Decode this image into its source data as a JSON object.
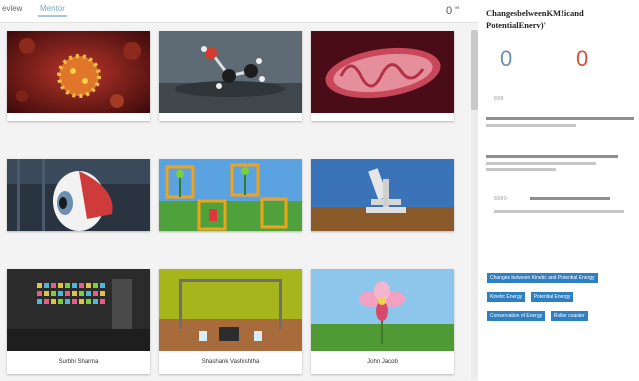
{
  "tabs": {
    "review": "eview",
    "mentor": "Mentor",
    "count": "0 \""
  },
  "tiles": [
    {
      "caption": ""
    },
    {
      "caption": ""
    },
    {
      "caption": ""
    },
    {
      "caption": ""
    },
    {
      "caption": ""
    },
    {
      "caption": ""
    },
    {
      "caption": "Surbhi Sharma"
    },
    {
      "caption": "Shashank Vashishtha"
    },
    {
      "caption": "John Jacob"
    }
  ],
  "panel": {
    "title": "ChangesbelweenKM!icand PotentialEnerv)'",
    "kinetic_score": "0",
    "potential_score": "0",
    "faint_1": "888",
    "faint_2": "8880"
  },
  "tags": [
    "Changes between Kinetic and Potential Energy",
    "Kinetic Energy",
    "Potential Energy",
    "Conservation of Energy",
    "Roller coaster"
  ],
  "colors": {
    "tag": "#2f7fc3",
    "kinetic": "#6d8fb5",
    "potential": "#d35235"
  },
  "icons": [
    "virus-icon",
    "molecule-icon",
    "mitochondria-icon",
    "eye-icon",
    "plants-icon",
    "microscope-icon",
    "periodic-table-icon",
    "lab-bench-icon",
    "flower-icon"
  ]
}
